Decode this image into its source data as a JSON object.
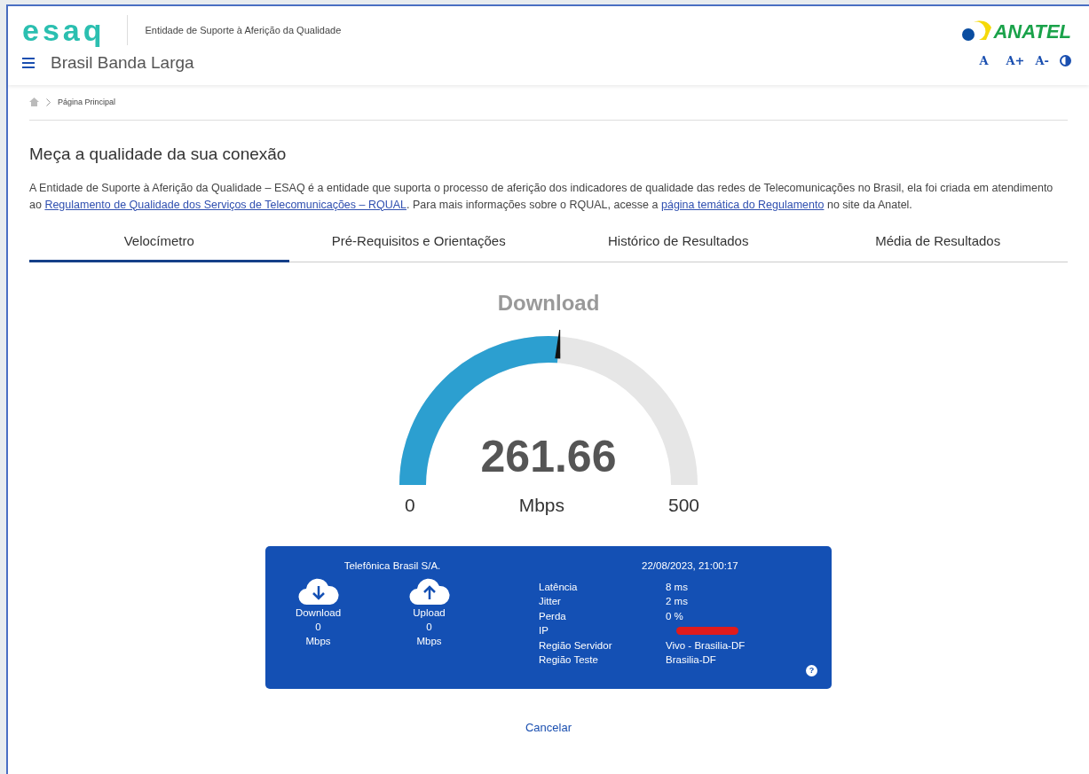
{
  "header": {
    "logo": "esaq",
    "tagline": "Entidade de Suporte à Aferição da Qualidade",
    "site_title": "Brasil Banda Larga",
    "brand": "ANATEL",
    "font_controls": [
      "A",
      "A+",
      "A-"
    ]
  },
  "breadcrumb": [
    "Página Principal"
  ],
  "heading": "Meça a qualidade da sua conexão",
  "intro": [
    {
      "kind": "text",
      "text": "A Entidade de Suporte à Aferição da Qualidade – ESAQ é a entidade que suporta o processo de aferição dos indicadores de qualidade das redes de Telecomunicações no Brasil, ela foi criada em atendimento ao "
    },
    {
      "kind": "link",
      "text": "Regulamento de Qualidade dos Serviços de Telecomunicações – RQUAL"
    },
    {
      "kind": "text",
      "text": ". Para mais informações sobre o RQUAL, acesse a "
    },
    {
      "kind": "link",
      "text": "página temática do Regulamento"
    },
    {
      "kind": "text",
      "text": " no site da Anatel."
    }
  ],
  "tabs": [
    {
      "label": "Velocímetro",
      "selected": true
    },
    {
      "label": "Pré-Requisitos e Orientações",
      "selected": false
    },
    {
      "label": "Histórico de Resultados",
      "selected": false
    },
    {
      "label": "Média de Resultados",
      "selected": false
    }
  ],
  "gauge": {
    "title": "Download",
    "value": "261.66",
    "unit": "Mbps",
    "min": "0",
    "max": "500"
  },
  "result": {
    "provider": "Telefônica Brasil S/A.",
    "datetime": "22/08/2023, 21:00:17",
    "speeds": [
      {
        "kind": "download",
        "label": "Download",
        "value": "0",
        "unit": "Mbps"
      },
      {
        "kind": "upload",
        "label": "Upload",
        "value": "0",
        "unit": "Mbps"
      }
    ],
    "metrics": [
      {
        "label": "Latência",
        "value": "8 ms"
      },
      {
        "label": "Jitter",
        "value": "2 ms"
      },
      {
        "label": "Perda",
        "value": "0 %"
      },
      {
        "label": "IP",
        "redacted": true
      },
      {
        "label": "Região Servidor",
        "value": "Vivo - Brasilia-DF"
      },
      {
        "label": "Região Teste",
        "value": "Brasilia-DF"
      }
    ],
    "help": "?"
  },
  "cancel": "Cancelar"
}
